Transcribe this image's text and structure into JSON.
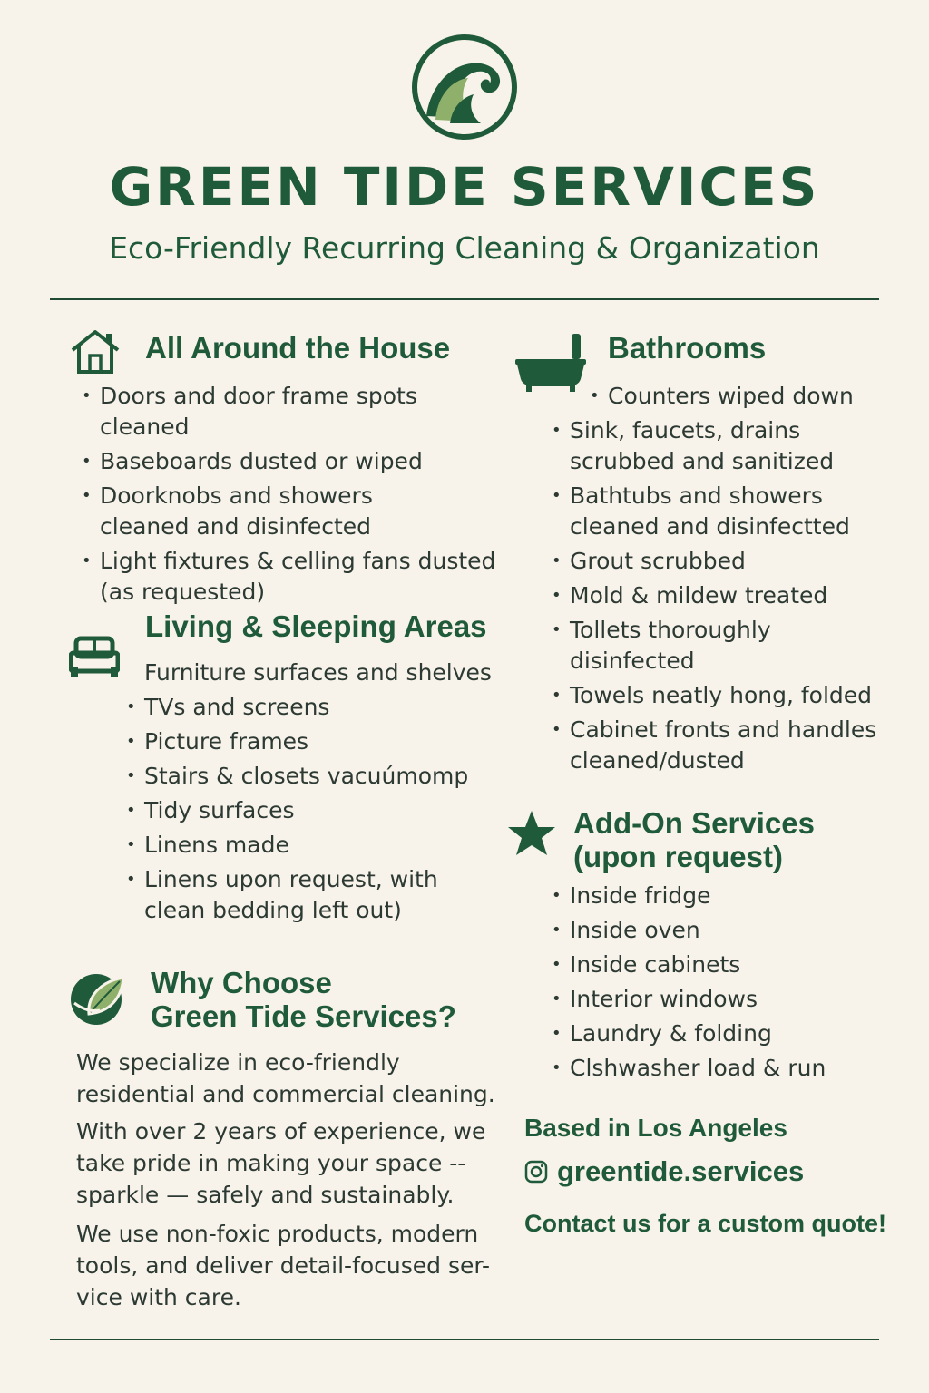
{
  "header": {
    "title": "GREEN TIDE SERVICES",
    "subtitle": "Eco-Friendly Recurring Cleaning & Organization",
    "logo_icon": "wave-logo-icon"
  },
  "colors": {
    "background": "#f8f3ea",
    "primary_green": "#1f5a3a",
    "light_green": "#8fb06a",
    "text": "#2c3a33"
  },
  "house": {
    "heading": "All Around the House",
    "icon": "house-icon",
    "items": [
      "Doors and door frame spots cleaned",
      "Baseboards dusted or wiped",
      "Doorknobs and showers cleaned and disinfected",
      "Light fixtures & celling fans dusted (as requested)"
    ]
  },
  "living": {
    "heading": "Living & Sleeping Areas",
    "icon": "sofa-icon",
    "first_item": "Furniture surfaces and shelves",
    "items": [
      "TVs and screens",
      "Picture frames",
      "Stairs & closets vacuúmomp",
      "Tidy surfaces",
      "Linens made",
      "Linens upon request, with clean bedding left out)"
    ]
  },
  "why": {
    "heading_line1": "Why Choose",
    "heading_line2": "Green Tide Services?",
    "icon": "leaf-icon",
    "paragraphs": [
      "We specialize in eco-friendly residential and commercial cleaning.",
      "With over 2 years of experience, we take pride in making your space -- sparkle — safely and sustainably.",
      "We use non-foxic products, modern tools, and deliver detail-focused ser-vice with care."
    ]
  },
  "bathrooms": {
    "heading": "Bathrooms",
    "icon": "bathtub-icon",
    "items": [
      "Counters wiped down",
      "Sink, faucets, drains scrubbed and sanitized",
      "Bathtubs and showers cleaned and disinfectted",
      "Grout scrubbed",
      "Mold & mildew treated",
      "Tollets thoroughly disinfected",
      "Towels neatly hong, folded",
      "Cabinet fronts and handles cleaned/dusted"
    ]
  },
  "addons": {
    "heading_line1": "Add-On Services",
    "heading_line2": "(upon request)",
    "icon": "star-icon",
    "items": [
      "Inside fridge",
      "Inside oven",
      "Inside cabinets",
      "Interior windows",
      "Laundry & folding",
      "Clshwasher load & run"
    ]
  },
  "contact": {
    "location": "Based in Los Angeles",
    "instagram_icon": "instagram-icon",
    "handle": "greentide.services",
    "cta": "Contact us for a custom quote!"
  }
}
